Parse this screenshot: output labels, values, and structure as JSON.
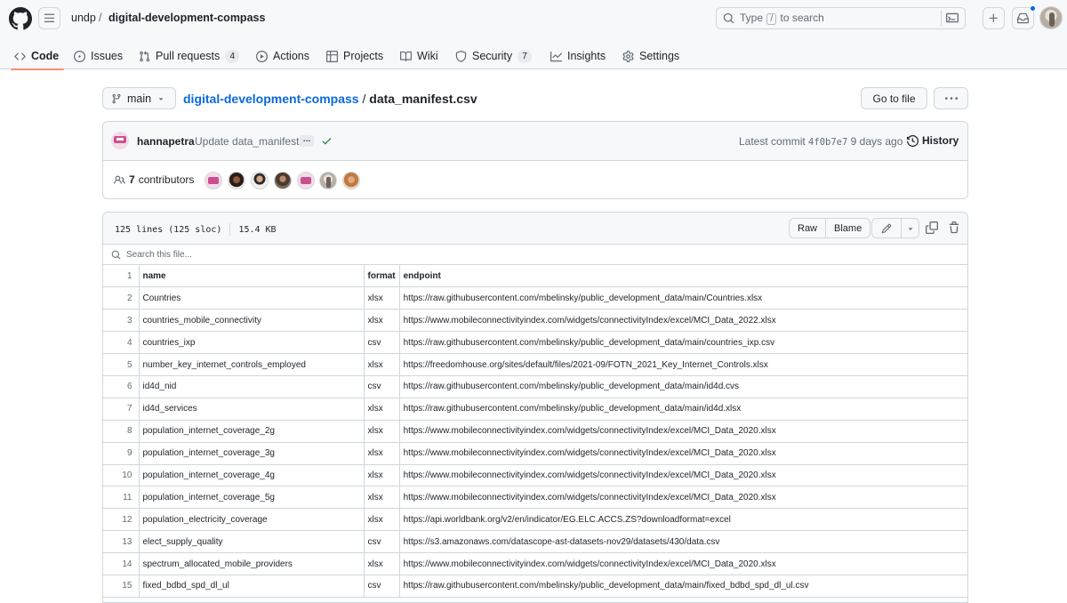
{
  "header": {
    "owner": "undp",
    "separator": "/",
    "repo": "digital-development-compass",
    "search_prefix": "Type",
    "search_key": "/",
    "search_suffix": "to search"
  },
  "nav": {
    "tabs": [
      {
        "label": "Code",
        "icon": "code-icon",
        "active": true
      },
      {
        "label": "Issues",
        "icon": "issue-icon"
      },
      {
        "label": "Pull requests",
        "icon": "pull-request-icon",
        "count": "4"
      },
      {
        "label": "Actions",
        "icon": "play-icon"
      },
      {
        "label": "Projects",
        "icon": "table-icon"
      },
      {
        "label": "Wiki",
        "icon": "book-icon"
      },
      {
        "label": "Security",
        "icon": "shield-icon",
        "count": "7"
      },
      {
        "label": "Insights",
        "icon": "graph-icon"
      },
      {
        "label": "Settings",
        "icon": "gear-icon"
      }
    ]
  },
  "file": {
    "branch": "main",
    "repo_link": "digital-development-compass",
    "path_sep": "/",
    "filename": "data_manifest.csv",
    "goto_label": "Go to file"
  },
  "commit": {
    "author": "hannapetra",
    "message": "Update data_manifest",
    "ellipsis": "…",
    "latest_label": "Latest commit",
    "sha": "4f0b7e7",
    "age": "9 days ago",
    "history_label": "History",
    "contributors_count": "7",
    "contributors_label": "contributors"
  },
  "viewer": {
    "lines": "125 lines (125 sloc)",
    "size": "15.4 KB",
    "raw_label": "Raw",
    "blame_label": "Blame",
    "search_placeholder": "Search this file..."
  },
  "csv": {
    "headers": [
      "name",
      "format",
      "endpoint"
    ],
    "rows": [
      {
        "ln": "2",
        "name": "Countries",
        "format": "xlsx",
        "endpoint": "https://raw.githubusercontent.com/mbelinsky/public_development_data/main/Countries.xlsx"
      },
      {
        "ln": "3",
        "name": "countries_mobile_connectivity",
        "format": "xlsx",
        "endpoint": "https://www.mobileconnectivityindex.com/widgets/connectivityIndex/excel/MCI_Data_2022.xlsx"
      },
      {
        "ln": "4",
        "name": "countries_ixp",
        "format": "csv",
        "endpoint": "https://raw.githubusercontent.com/mbelinsky/public_development_data/main/countries_ixp.csv"
      },
      {
        "ln": "5",
        "name": "number_key_internet_controls_employed",
        "format": "xlsx",
        "endpoint": "https://freedomhouse.org/sites/default/files/2021-09/FOTN_2021_Key_Internet_Controls.xlsx"
      },
      {
        "ln": "6",
        "name": "id4d_nid",
        "format": "csv",
        "endpoint": "https://raw.githubusercontent.com/mbelinsky/public_development_data/main/id4d.cvs"
      },
      {
        "ln": "7",
        "name": "id4d_services",
        "format": "xlsx",
        "endpoint": "https://raw.githubusercontent.com/mbelinsky/public_development_data/main/id4d.xlsx"
      },
      {
        "ln": "8",
        "name": "population_internet_coverage_2g",
        "format": "xlsx",
        "endpoint": "https://www.mobileconnectivityindex.com/widgets/connectivityIndex/excel/MCI_Data_2020.xlsx"
      },
      {
        "ln": "9",
        "name": "population_internet_coverage_3g",
        "format": "xlsx",
        "endpoint": "https://www.mobileconnectivityindex.com/widgets/connectivityIndex/excel/MCI_Data_2020.xlsx"
      },
      {
        "ln": "10",
        "name": "population_internet_coverage_4g",
        "format": "xlsx",
        "endpoint": "https://www.mobileconnectivityindex.com/widgets/connectivityIndex/excel/MCI_Data_2020.xlsx"
      },
      {
        "ln": "11",
        "name": "population_internet_coverage_5g",
        "format": "xlsx",
        "endpoint": "https://www.mobileconnectivityindex.com/widgets/connectivityIndex/excel/MCI_Data_2020.xlsx"
      },
      {
        "ln": "12",
        "name": "population_electricity_coverage",
        "format": "xlsx",
        "endpoint": "https://api.worldbank.org/v2/en/indicator/EG.ELC.ACCS.ZS?downloadformat=excel"
      },
      {
        "ln": "13",
        "name": "elect_supply_quality",
        "format": "csv",
        "endpoint": "https://s3.amazonaws.com/datascope-ast-datasets-nov29/datasets/430/data.csv"
      },
      {
        "ln": "14",
        "name": "spectrum_allocated_mobile_providers",
        "format": "xlsx",
        "endpoint": "https://www.mobileconnectivityindex.com/widgets/connectivityIndex/excel/MCI_Data_2020.xlsx"
      },
      {
        "ln": "15",
        "name": "fixed_bdbd_spd_dl_ul",
        "format": "csv",
        "endpoint": "https://raw.githubusercontent.com/mbelinsky/public_development_data/main/fixed_bdbd_spd_dl_ul.csv"
      }
    ]
  },
  "colors": {
    "accent_link": "#0969da",
    "active_tab_underline": "#fd8c73",
    "success_check": "#1a7f37"
  }
}
